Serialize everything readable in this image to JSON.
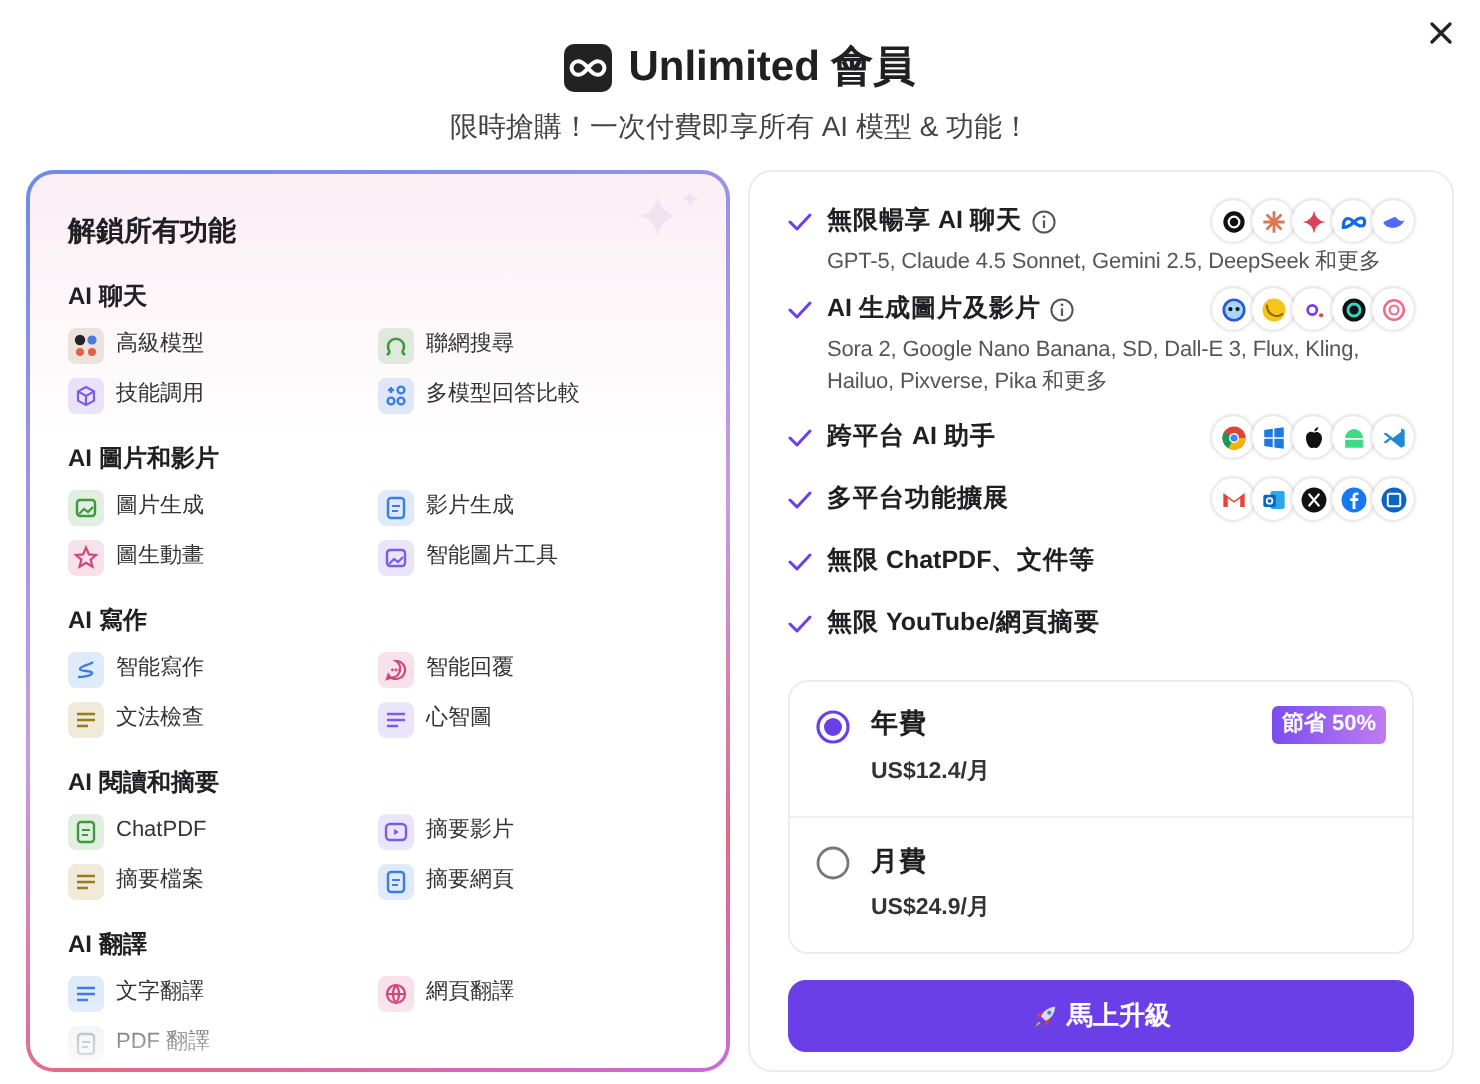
{
  "header": {
    "title": "Unlimited 會員",
    "subtitle": "限時搶購！一次付費即享所有 AI 模型 & 功能！"
  },
  "features_panel": {
    "title": "解鎖所有功能",
    "sections": [
      {
        "title": "AI 聊天",
        "items": [
          {
            "label": "高級模型",
            "kind": "models"
          },
          {
            "label": "聯網搜尋",
            "kind": "search"
          },
          {
            "label": "技能調用",
            "kind": "cube"
          },
          {
            "label": "多模型回答比較",
            "kind": "grid"
          }
        ]
      },
      {
        "title": "AI 圖片和影片",
        "items": [
          {
            "label": "圖片生成",
            "kind": "image"
          },
          {
            "label": "影片生成",
            "kind": "video_doc"
          },
          {
            "label": "圖生動畫",
            "kind": "star"
          },
          {
            "label": "智能圖片工具",
            "kind": "image_tool"
          }
        ]
      },
      {
        "title": "AI 寫作",
        "items": [
          {
            "label": "智能寫作",
            "kind": "pen"
          },
          {
            "label": "智能回覆",
            "kind": "chat"
          },
          {
            "label": "文法檢查",
            "kind": "grammar"
          },
          {
            "label": "心智圖",
            "kind": "mindmap"
          }
        ]
      },
      {
        "title": "AI 閱讀和摘要",
        "items": [
          {
            "label": "ChatPDF",
            "kind": "pdf"
          },
          {
            "label": "摘要影片",
            "kind": "video"
          },
          {
            "label": "摘要檔案",
            "kind": "file"
          },
          {
            "label": "摘要網頁",
            "kind": "page"
          }
        ]
      },
      {
        "title": "AI 翻譯",
        "items": [
          {
            "label": "文字翻譯",
            "kind": "translate"
          },
          {
            "label": "網頁翻譯",
            "kind": "globe"
          },
          {
            "label": "PDF 翻譯",
            "kind": "pdf_translate"
          }
        ]
      }
    ]
  },
  "benefits": [
    {
      "title": "無限暢享 AI 聊天",
      "info": true,
      "kind": "chat_models",
      "detail": "GPT-5, Claude 4.5 Sonnet, Gemini 2.5, DeepSeek 和更多"
    },
    {
      "title": "AI 生成圖片及影片",
      "info": true,
      "kind": "media_models",
      "detail": "Sora 2, Google Nano Banana, SD, Dall-E 3, Flux, Kling, Hailuo, Pixverse, Pika 和更多"
    },
    {
      "title": "跨平台 AI 助手",
      "info": false,
      "kind": "platforms"
    },
    {
      "title": "多平台功能擴展",
      "info": false,
      "kind": "apps"
    },
    {
      "title": "無限 ChatPDF、文件等",
      "info": false
    },
    {
      "title": "無限 YouTube/網頁摘要",
      "info": false
    }
  ],
  "plans": [
    {
      "name": "年費",
      "price": "US$12.4/月",
      "badge": "節省 50%",
      "selected": true
    },
    {
      "name": "月費",
      "price": "US$24.9/月",
      "selected": false
    }
  ],
  "upgrade_button": {
    "label": "馬上升級"
  }
}
